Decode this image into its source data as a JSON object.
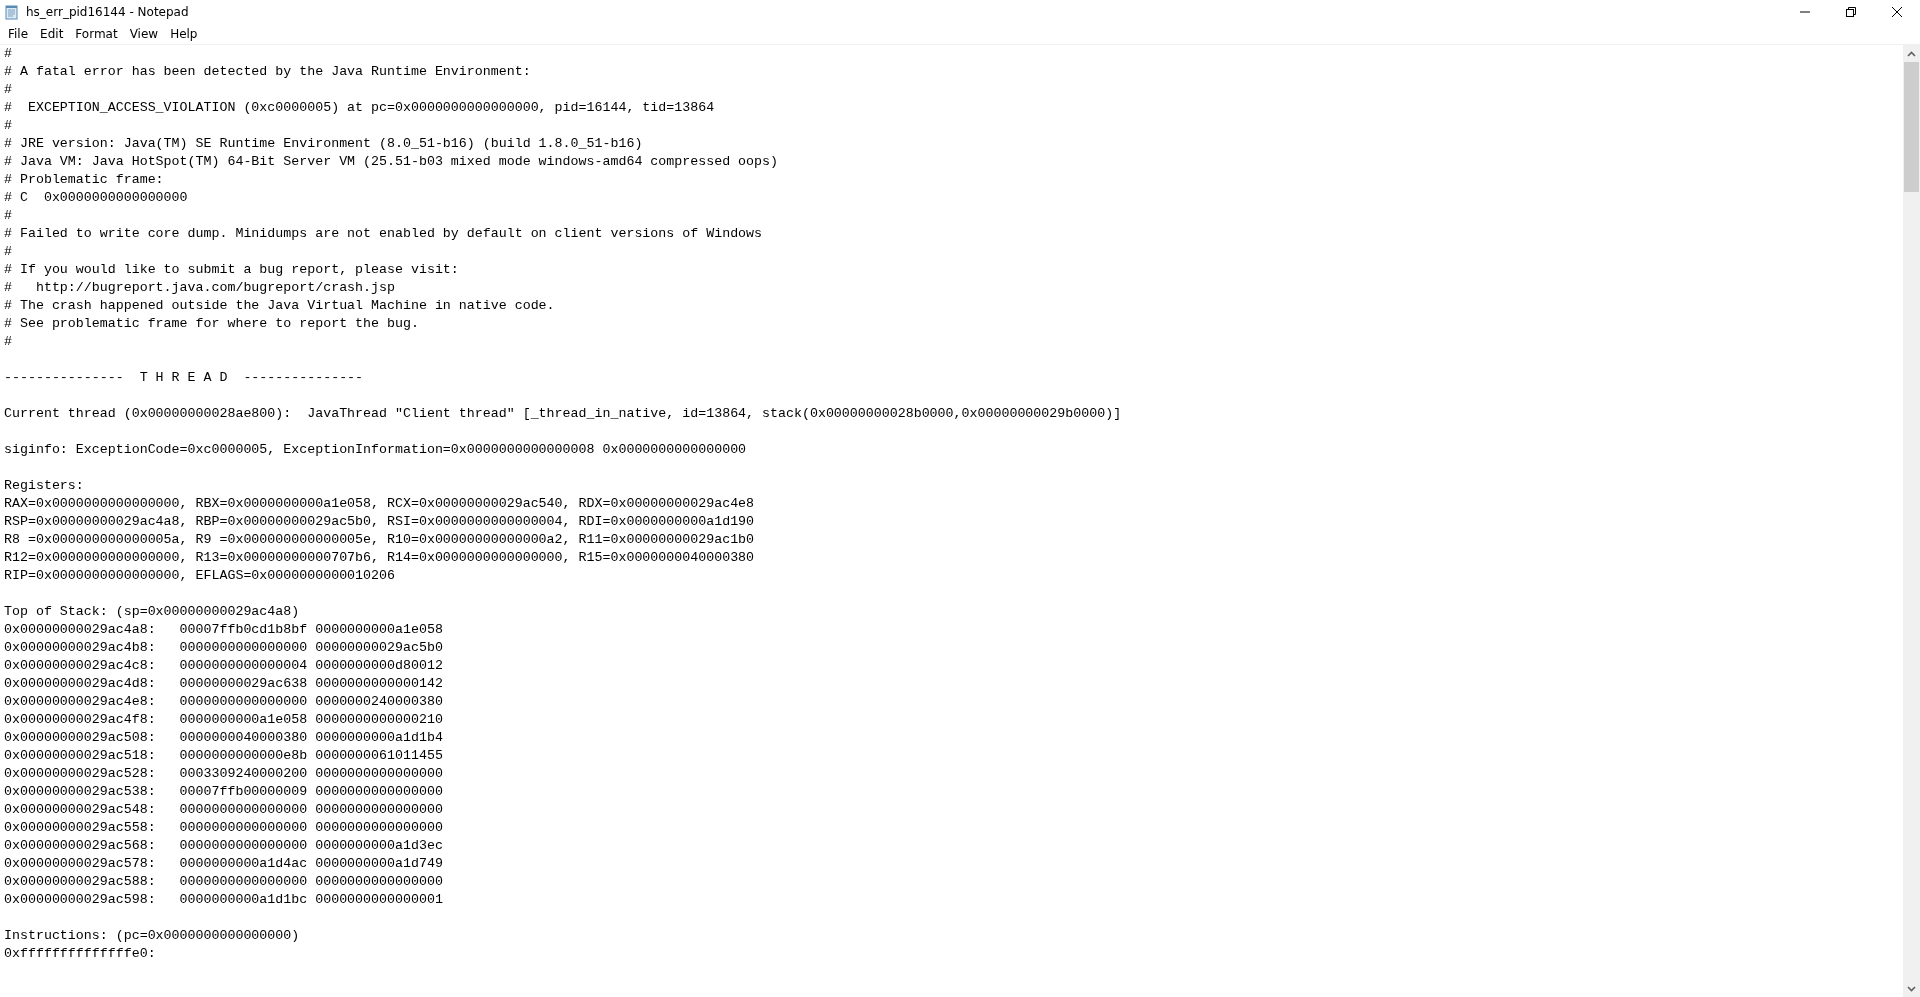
{
  "window": {
    "title": "hs_err_pid16144 - Notepad"
  },
  "menu": [
    "File",
    "Edit",
    "Format",
    "View",
    "Help"
  ],
  "editor": {
    "blocks": [
      [
        "#",
        "# A fatal error has been detected by the Java Runtime Environment:",
        "#",
        "#  EXCEPTION_ACCESS_VIOLATION (0xc0000005) at pc=0x0000000000000000, pid=16144, tid=13864",
        "#",
        "# JRE version: Java(TM) SE Runtime Environment (8.0_51-b16) (build 1.8.0_51-b16)",
        "# Java VM: Java HotSpot(TM) 64-Bit Server VM (25.51-b03 mixed mode windows-amd64 compressed oops)",
        "# Problematic frame:",
        "# C  0x0000000000000000",
        "#",
        "# Failed to write core dump. Minidumps are not enabled by default on client versions of Windows",
        "#",
        "# If you would like to submit a bug report, please visit:",
        "#   http://bugreport.java.com/bugreport/crash.jsp",
        "# The crash happened outside the Java Virtual Machine in native code.",
        "# See problematic frame for where to report the bug.",
        "#"
      ],
      [
        "---------------  T H R E A D  ---------------"
      ],
      [
        "Current thread (0x00000000028ae800):  JavaThread \"Client thread\" [_thread_in_native, id=13864, stack(0x00000000028b0000,0x00000000029b0000)]"
      ],
      [
        "siginfo: ExceptionCode=0xc0000005, ExceptionInformation=0x0000000000000008 0x0000000000000000"
      ],
      [
        "Registers:",
        "RAX=0x0000000000000000, RBX=0x0000000000a1e058, RCX=0x00000000029ac540, RDX=0x00000000029ac4e8",
        "RSP=0x00000000029ac4a8, RBP=0x00000000029ac5b0, RSI=0x0000000000000004, RDI=0x0000000000a1d190",
        "R8 =0x000000000000005a, R9 =0x000000000000005e, R10=0x00000000000000a2, R11=0x00000000029ac1b0",
        "R12=0x0000000000000000, R13=0x00000000000707b6, R14=0x0000000000000000, R15=0x0000000040000380",
        "RIP=0x0000000000000000, EFLAGS=0x0000000000010206"
      ],
      [
        "Top of Stack: (sp=0x00000000029ac4a8)",
        "0x00000000029ac4a8:   00007ffb0cd1b8bf 0000000000a1e058",
        "0x00000000029ac4b8:   0000000000000000 00000000029ac5b0",
        "0x00000000029ac4c8:   0000000000000004 0000000000d80012",
        "0x00000000029ac4d8:   00000000029ac638 0000000000000142",
        "0x00000000029ac4e8:   0000000000000000 0000000240000380",
        "0x00000000029ac4f8:   0000000000a1e058 0000000000000210",
        "0x00000000029ac508:   0000000040000380 0000000000a1d1b4",
        "0x00000000029ac518:   0000000000000e8b 0000000061011455",
        "0x00000000029ac528:   0003309240000200 0000000000000000",
        "0x00000000029ac538:   00007ffb00000009 0000000000000000",
        "0x00000000029ac548:   0000000000000000 0000000000000000",
        "0x00000000029ac558:   0000000000000000 0000000000000000",
        "0x00000000029ac568:   0000000000000000 0000000000a1d3ec",
        "0x00000000029ac578:   0000000000a1d4ac 0000000000a1d749",
        "0x00000000029ac588:   0000000000000000 0000000000000000",
        "0x00000000029ac598:   0000000000a1d1bc 0000000000000001"
      ],
      [
        "Instructions: (pc=0x0000000000000000)",
        "0xffffffffffffffe0:"
      ]
    ]
  }
}
